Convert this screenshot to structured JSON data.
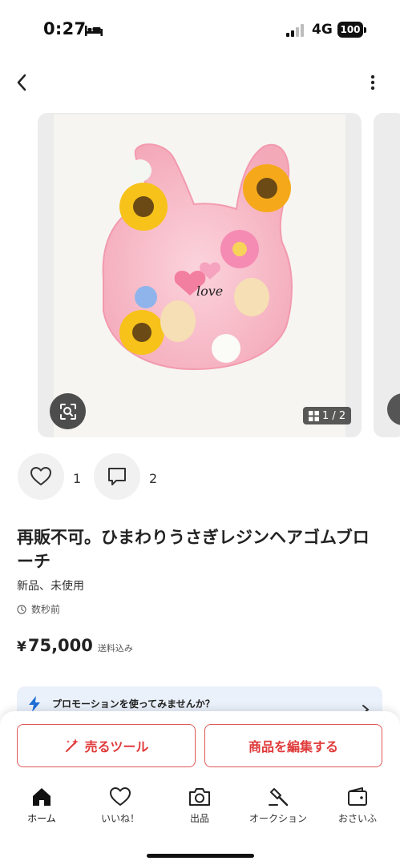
{
  "status_bar": {
    "time": "0:27",
    "network": "4G",
    "battery": "100"
  },
  "nav": {
    "back_icon": "chevron-left-icon",
    "more_icon": "more-vertical-icon"
  },
  "gallery": {
    "counter": "1 / 2",
    "photo_caption": "love",
    "lens_icon": "image-search-icon"
  },
  "reactions": {
    "likes": "1",
    "comments": "2"
  },
  "item": {
    "title": "再販不可。ひまわりうさぎレジンヘアゴムブローチ",
    "condition": "新品、未使用",
    "posted": "数秒前",
    "price_symbol": "¥",
    "price": "75,000",
    "price_note": "送料込み"
  },
  "promo": {
    "text": "プロモーションを使ってみませんか？"
  },
  "actions": {
    "sell_tools": "売るツール",
    "edit_item": "商品を編集する"
  },
  "tabs": [
    {
      "label": "ホーム",
      "icon": "home-icon"
    },
    {
      "label": "いいね！",
      "icon": "heart-icon"
    },
    {
      "label": "出品",
      "icon": "camera-icon"
    },
    {
      "label": "オークション",
      "icon": "gavel-icon"
    },
    {
      "label": "おさいふ",
      "icon": "wallet-icon"
    }
  ],
  "colors": {
    "accent": "#e03a3a",
    "promo_bg": "#eaf1fb",
    "promo_icon": "#1f6fd6"
  }
}
